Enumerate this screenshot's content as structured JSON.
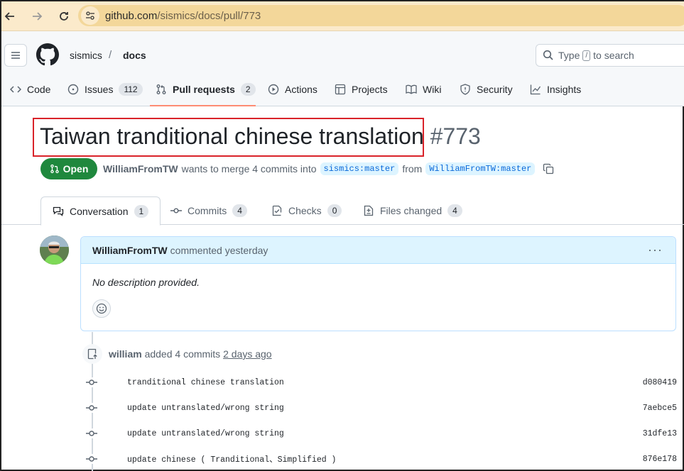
{
  "browser": {
    "url_host": "github.com",
    "url_path": "/sismics/docs/pull/773"
  },
  "header": {
    "owner": "sismics",
    "separator": "/",
    "repo": "docs",
    "search_prefix": "Type",
    "search_key": "/",
    "search_suffix": "to search"
  },
  "repo_nav": {
    "code": "Code",
    "issues": "Issues",
    "issues_count": "112",
    "pull_requests": "Pull requests",
    "pull_requests_count": "2",
    "actions": "Actions",
    "projects": "Projects",
    "wiki": "Wiki",
    "security": "Security",
    "insights": "Insights"
  },
  "pr": {
    "title": "Taiwan tranditional chinese translation",
    "number": "#773",
    "state": "Open",
    "author": "WilliamFromTW",
    "merge_text": "wants to merge 4 commits into",
    "base_branch": "sismics:master",
    "from_text": "from",
    "head_branch": "WilliamFromTW:master"
  },
  "tabs": {
    "conversation": "Conversation",
    "conversation_count": "1",
    "commits": "Commits",
    "commits_count": "4",
    "checks": "Checks",
    "checks_count": "0",
    "files_changed": "Files changed",
    "files_changed_count": "4"
  },
  "comment": {
    "author": "WilliamFromTW",
    "action": "commented yesterday",
    "body": "No description provided.",
    "menu": "···"
  },
  "timeline": {
    "author": "william",
    "action": "added 4 commits",
    "time": "2 days ago",
    "commits": [
      {
        "message": "tranditional chinese translation",
        "sha": "d080419"
      },
      {
        "message": "update untranslated/wrong string",
        "sha": "7aebce5"
      },
      {
        "message": "update untranslated/wrong string",
        "sha": "31dfe13"
      },
      {
        "message": "update chinese ( Tranditional、Simplified )",
        "sha": "876e178"
      }
    ]
  },
  "colors": {
    "browser_bar": "#fbeacb",
    "url_pill": "#f3d79a",
    "open_green": "#1f883d",
    "nav_underline": "#fd8c73",
    "highlight_red": "#d9232a",
    "branch_blue": "#0969da"
  }
}
